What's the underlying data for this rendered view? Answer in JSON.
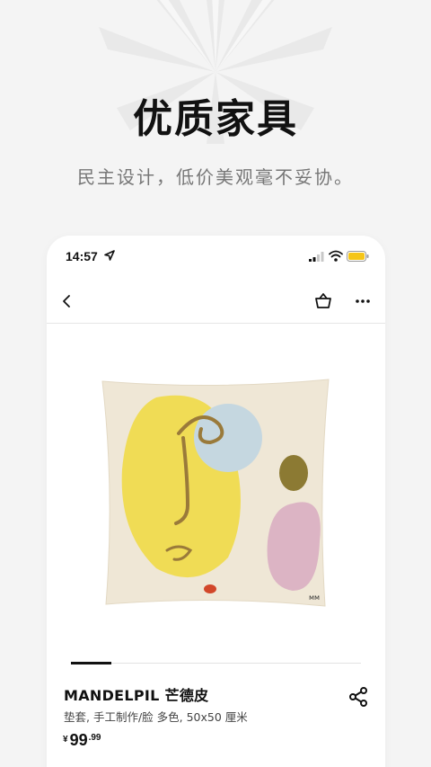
{
  "hero": {
    "title": "优质家具",
    "subtitle": "民主设计，低价美观毫不妥协。"
  },
  "status_bar": {
    "time": "14:57",
    "icons": [
      "location-arrow-icon",
      "signal-icon",
      "wifi-icon",
      "battery-icon"
    ],
    "battery_color": "#f5c518"
  },
  "nav": {
    "icons": [
      "back-chevron-icon",
      "basket-icon",
      "more-dots-icon"
    ]
  },
  "product": {
    "name": "MANDELPIL 芒德皮",
    "description": "垫套, 手工制作/脸 多色, 50x50 厘米",
    "price": {
      "currency": "¥",
      "integer": "99",
      "decimal": ".99"
    },
    "image_icon": "cushion-cover-face-illustration",
    "share_icon": "share-icon",
    "carousel": {
      "active_index": 0
    }
  },
  "colors": {
    "background": "#f4f4f4",
    "card": "#ffffff",
    "text": "#111111",
    "subtitle": "#777777"
  }
}
